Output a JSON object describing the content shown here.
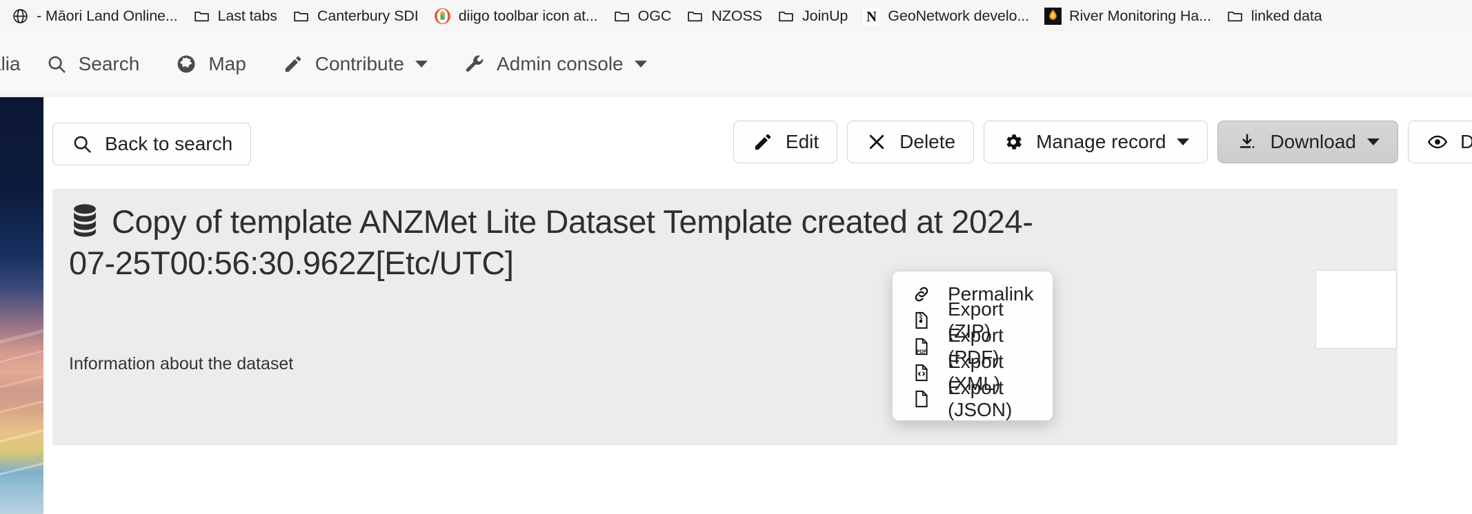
{
  "browser": {
    "bookmarks": [
      {
        "label": "- Māori Land Online...",
        "icon": "globe-icon"
      },
      {
        "label": "Last tabs",
        "icon": "folder-icon"
      },
      {
        "label": "Canterbury SDI",
        "icon": "folder-icon"
      },
      {
        "label": "diigo toolbar icon at...",
        "icon": "diigo-icon"
      },
      {
        "label": "OGC",
        "icon": "folder-icon"
      },
      {
        "label": "NZOSS",
        "icon": "folder-icon"
      },
      {
        "label": "JoinUp",
        "icon": "folder-icon"
      },
      {
        "label": "GeoNetwork develo...",
        "icon": "geonetwork-n-icon"
      },
      {
        "label": "River Monitoring Ha...",
        "icon": "river-monitoring-icon"
      },
      {
        "label": "linked data",
        "icon": "folder-icon"
      }
    ]
  },
  "topnav": {
    "brand": "alia",
    "items": [
      {
        "label": "Search",
        "icon": "search-icon",
        "caret": false
      },
      {
        "label": "Map",
        "icon": "globe-icon",
        "caret": false
      },
      {
        "label": "Contribute",
        "icon": "pencil-icon",
        "caret": true
      },
      {
        "label": "Admin console",
        "icon": "wrench-icon",
        "caret": true
      }
    ]
  },
  "toolbar": {
    "back_label": "Back to search",
    "back_icon": "search-icon",
    "edit_label": "Edit",
    "edit_icon": "pencil-icon",
    "delete_label": "Delete",
    "delete_icon": "close-x-icon",
    "manage_label": "Manage record",
    "manage_icon": "gear-icon",
    "download_label": "Download",
    "download_icon": "download-icon",
    "display_label": "Disp",
    "display_icon": "eye-icon"
  },
  "download_menu": {
    "open": true,
    "items": [
      {
        "label": "Permalink",
        "icon": "link-icon"
      },
      {
        "label": "Export (ZIP)",
        "icon": "file-zip-icon"
      },
      {
        "label": "Export (PDF)",
        "icon": "file-pdf-icon"
      },
      {
        "label": "Export (XML)",
        "icon": "file-xml-icon"
      },
      {
        "label": "Export (JSON)",
        "icon": "file-blank-icon"
      }
    ]
  },
  "record": {
    "icon": "database-icon",
    "title": "Copy of template ANZMet Lite Dataset Template created at 2024-07-25T00:56:30.962Z[Etc/UTC]",
    "abstract": "Information about the dataset"
  },
  "colors": {
    "page_background": "#ffffff",
    "panel_background": "#ececec",
    "nav_background": "#f8f8f8",
    "bookmark_background": "#f6f6f6",
    "button_active": "#d2d2d2",
    "text_primary": "#2f2f2f"
  }
}
